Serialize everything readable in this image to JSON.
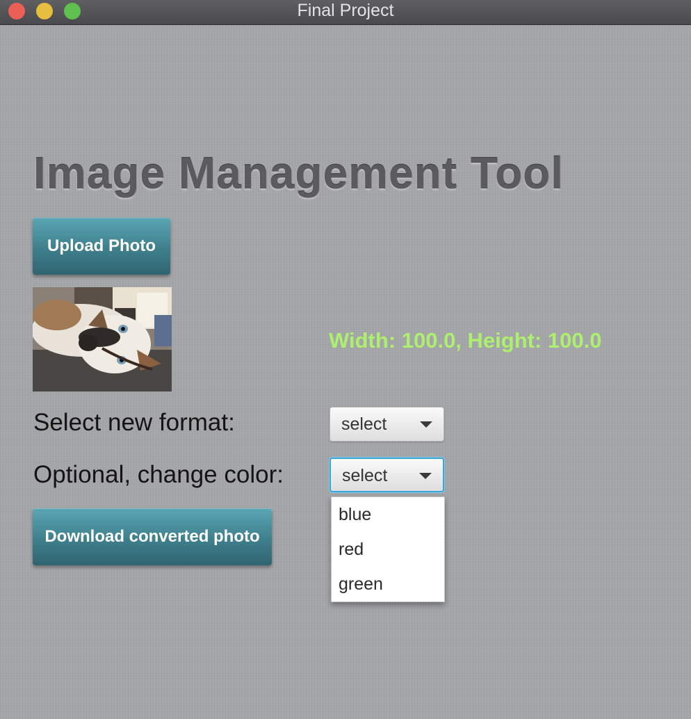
{
  "window": {
    "title": "Final Project"
  },
  "heading": "Image Management Tool",
  "upload_button": "Upload Photo",
  "photo": {
    "icon": "dog-photo-thumbnail"
  },
  "dimensions_text": "Width: 100.0, Height: 100.0",
  "format": {
    "label": "Select new format:",
    "selected": "select"
  },
  "color": {
    "label": "Optional, change color:",
    "selected": "select",
    "options": [
      "blue",
      "red",
      "green"
    ]
  },
  "download_button": "Download converted photo",
  "colors": {
    "accent": "#3f7f8c",
    "dimensions_text": "#adef6f",
    "focus_ring": "#39a6d8"
  }
}
